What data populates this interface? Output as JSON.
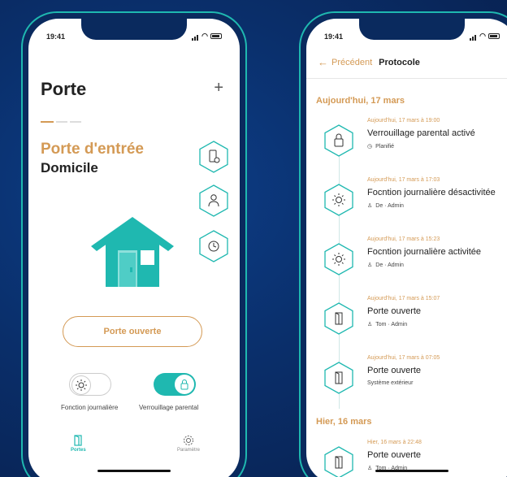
{
  "colors": {
    "accent": "#d49a55",
    "teal": "#1fb8b0",
    "background": "#0a2f6b"
  },
  "left_phone": {
    "status_time": "19:41",
    "title": "Porte",
    "add_icon": "plus-icon",
    "door_name": "Porte d'entrée",
    "location": "Domicile",
    "side_actions": [
      "door-settings-icon",
      "user-icon",
      "history-icon"
    ],
    "house_icon": "house-icon",
    "open_button": "Porte ouverte",
    "toggles": [
      {
        "label": "Fonction journalière",
        "icon": "sun-icon",
        "state": "off"
      },
      {
        "label": "Verrouillage parental",
        "icon": "lock-icon",
        "state": "on"
      }
    ],
    "tabs": [
      {
        "label": "Portes",
        "icon": "door-icon",
        "active": true
      },
      {
        "label": "Paramètre",
        "icon": "gear-icon",
        "active": false
      }
    ]
  },
  "right_phone": {
    "status_time": "19:41",
    "back_label": "Précédent",
    "title": "Protocole",
    "sections": [
      {
        "label": "Aujourd'hui, 17 mars"
      },
      {
        "label": "Hier, 16 mars"
      }
    ],
    "items": [
      {
        "time": "Aujourd'hui, 17 mars à 19:00",
        "title": "Verrouillage parental activé",
        "meta": "Planifié",
        "icon": "lock-icon",
        "meta_icon": "clock-icon"
      },
      {
        "time": "Aujourd'hui, 17 mars à 17:03",
        "title": "Focntion journalière désactivitée",
        "meta": "De · Admin",
        "icon": "sun-icon",
        "meta_icon": "person-icon"
      },
      {
        "time": "Aujourd'hui, 17 mars à 15:23",
        "title": "Focntion journalière activitée",
        "meta": "De · Admin",
        "icon": "sun-icon",
        "meta_icon": "person-icon"
      },
      {
        "time": "Aujourd'hui, 17 mars à 15:07",
        "title": "Porte ouverte",
        "meta": "Tom · Admin",
        "icon": "door-icon",
        "meta_icon": "person-icon"
      },
      {
        "time": "Aujourd'hui, 17 mars à 07:05",
        "title": "Porte ouverte",
        "meta": "Système extérieur",
        "icon": "door-icon",
        "meta_icon": ""
      },
      {
        "time": "Hier, 16 mars à 22:48",
        "title": "Porte ouverte",
        "meta": "Tom · Admin",
        "icon": "door-icon",
        "meta_icon": "person-icon"
      }
    ]
  }
}
